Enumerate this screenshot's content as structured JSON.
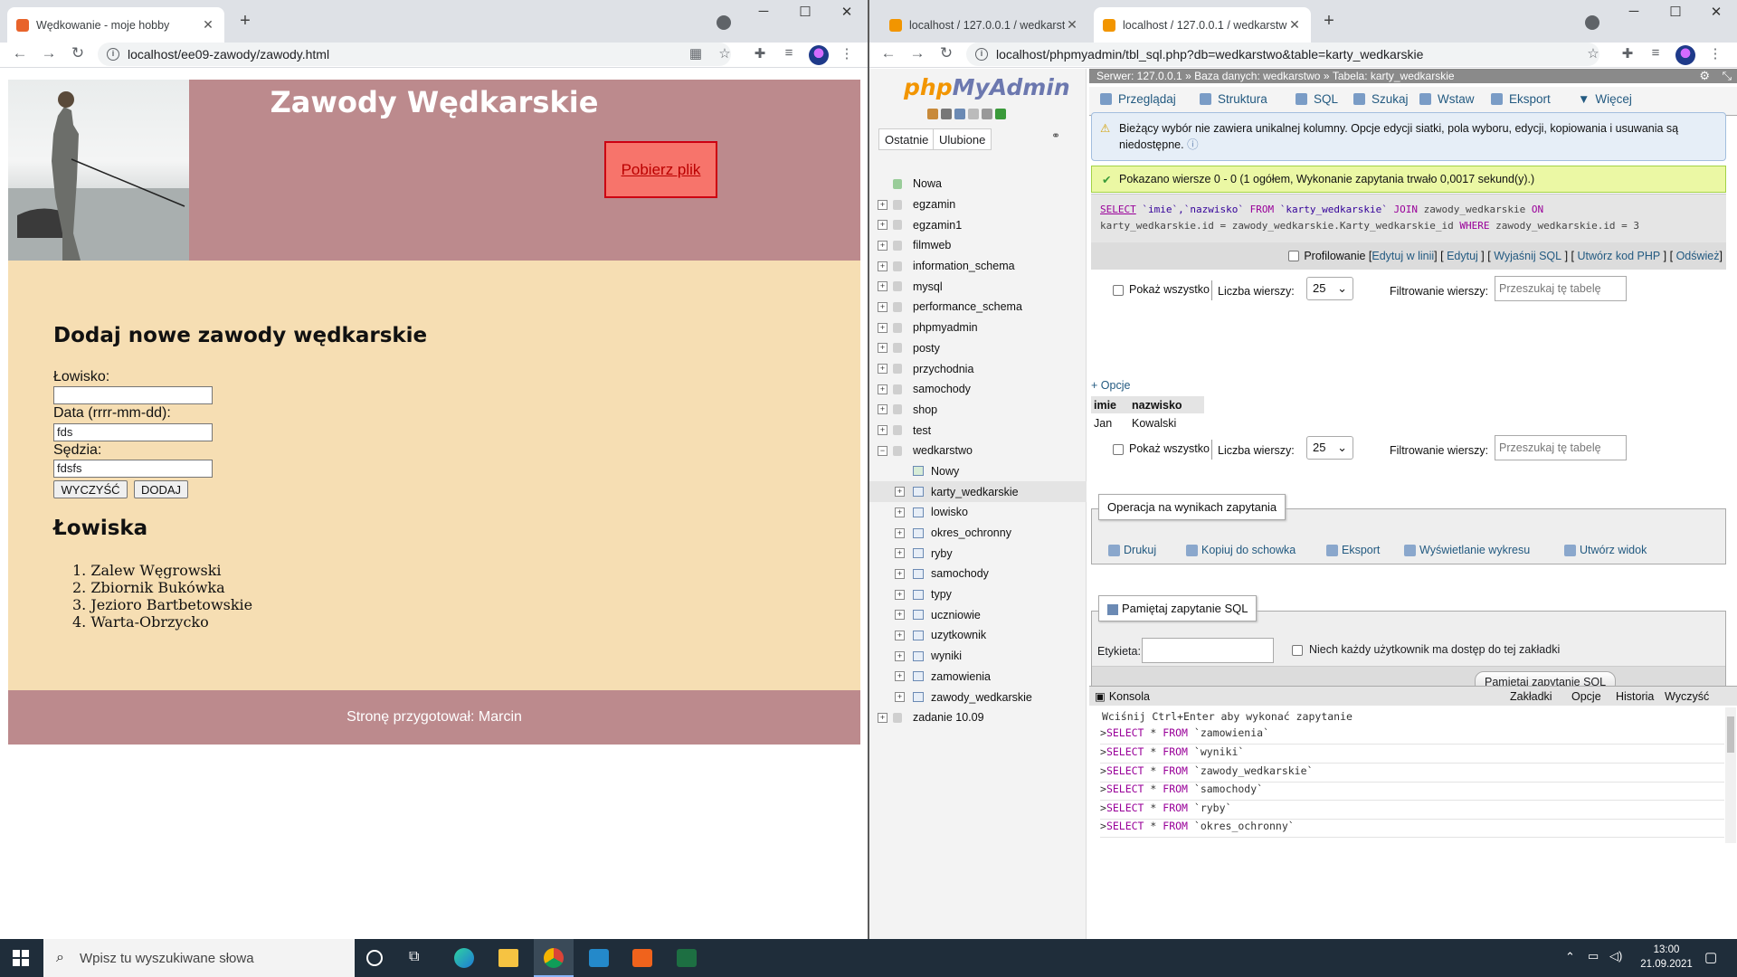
{
  "left_browser": {
    "tab_title": "Wędkowanie - moje hobby",
    "url": "localhost/ee09-zawody/zawody.html",
    "page": {
      "heading": "Zawody Wędkarskie",
      "download_button": "Pobierz plik",
      "form_heading": "Dodaj nowe zawody wędkarskie",
      "fields": [
        {
          "label": "Łowisko:",
          "value": ""
        },
        {
          "label": "Data (rrrr-mm-dd):",
          "value": "fds"
        },
        {
          "label": "Sędzia:",
          "value": "fdsfs"
        }
      ],
      "clear_button": "WYCZYŚĆ",
      "add_button": "DODAJ",
      "list_heading": "Łowiska",
      "fisheries": [
        "Zalew Węgrowski",
        "Zbiornik Bukówka",
        "Jezioro Bartbetowskie",
        "Warta-Obrzycko"
      ],
      "footer": "Stronę przygotował: Marcin"
    }
  },
  "right_browser": {
    "tabs": [
      "localhost / 127.0.0.1 / wedkarstw",
      "localhost / 127.0.0.1 / wedkarstw"
    ],
    "url": "localhost/phpmyadmin/tbl_sql.php?db=wedkarstwo&table=karty_wedkarskie",
    "logo_php": "php",
    "logo_admin": "MyAdmin",
    "nav_tabs": [
      "Ostatnie",
      "Ulubione"
    ],
    "tree": {
      "new": "Nowa",
      "databases_before": [
        "egzamin",
        "egzamin1",
        "filmweb",
        "information_schema",
        "mysql",
        "performance_schema",
        "phpmyadmin",
        "posty",
        "przychodnia",
        "samochody",
        "shop",
        "test"
      ],
      "open_db": "wedkarstwo",
      "open_db_new": "Nowy",
      "tables": [
        "karty_wedkarskie",
        "lowisko",
        "okres_ochronny",
        "ryby",
        "samochody",
        "typy",
        "uczniowie",
        "uzytkownik",
        "wyniki",
        "zamowienia",
        "zawody_wedkarskie"
      ],
      "databases_after": [
        "zadanie 10.09"
      ]
    },
    "breadcrumb": {
      "server": "Serwer: 127.0.0.1",
      "database": "Baza danych: wedkarstwo",
      "table": "Tabela: karty_wedkarskie"
    },
    "menu": [
      "Przeglądaj",
      "Struktura",
      "SQL",
      "Szukaj",
      "Wstaw",
      "Eksport",
      "Więcej"
    ],
    "notice": "Bieżący wybór nie zawiera unikalnej kolumny. Opcje edycji siatki, pola wyboru, edycji, kopiowania i usuwania są niedostępne.",
    "success": "Pokazano wiersze 0 - 0 (1 ogółem, Wykonanie zapytania trwało 0,0017 sekund(y).)",
    "sql": {
      "kw_select": "SELECT",
      "cols": " `imie`,`nazwisko` ",
      "kw_from": "FROM",
      "table": " `karty_wedkarskie` ",
      "kw_join": "JOIN",
      "rest1": " zawody_wedkarskie ",
      "kw_on": "ON",
      "line2a": "karty_wedkarskie.id = zawody_wedkarskie.Karty_wedkarskie_id ",
      "kw_where": "WHERE",
      "line2b": " zawody_wedkarskie.id = 3"
    },
    "profiling": {
      "label": "Profilowanie",
      "links": [
        "Edytuj w linii",
        "Edytuj",
        "Wyjaśnij SQL",
        "Utwórz kod PHP",
        "Odśwież"
      ]
    },
    "controls": {
      "show_all": "Pokaż wszystko",
      "row_count_label": "Liczba wierszy:",
      "row_count": "25",
      "filter_label": "Filtrowanie wierszy:",
      "filter_placeholder": "Przeszukaj tę tabelę"
    },
    "options_link": "+ Opcje",
    "result": {
      "columns": [
        "imie",
        "nazwisko"
      ],
      "rows": [
        [
          "Jan",
          "Kowalski"
        ]
      ]
    },
    "ops": {
      "legend": "Operacja na wynikach zapytania",
      "items": [
        "Drukuj",
        "Kopiuj do schowka",
        "Eksport",
        "Wyświetlanie wykresu",
        "Utwórz widok"
      ]
    },
    "bookmark": {
      "legend": "Pamiętaj zapytanie SQL",
      "label": "Etykieta:",
      "checkbox": "Niech każdy użytkownik ma dostęp do tej zakładki",
      "button": "Pamiętaj zapytanie SQL"
    },
    "console": {
      "title": "Konsola",
      "links": [
        "Zakładki",
        "Opcje",
        "Historia",
        "Wyczyść"
      ],
      "hint": "Wciśnij Ctrl+Enter aby wykonać zapytanie",
      "queries": [
        "`zamowienia`",
        "`wyniki`",
        "`zawody_wedkarskie`",
        "`samochody`",
        "`ryby`",
        "`okres_ochronny`"
      ],
      "kw_select": "SELECT",
      "kw_from": "FROM"
    }
  },
  "taskbar": {
    "search_placeholder": "Wpisz tu wyszukiwane słowa",
    "time": "13:00",
    "date": "21.09.2021"
  },
  "colors": {
    "banner": "#bc8a8d",
    "page_bg": "#f6deb3",
    "download_button": "#f7746b",
    "pma_link": "#235a81"
  }
}
